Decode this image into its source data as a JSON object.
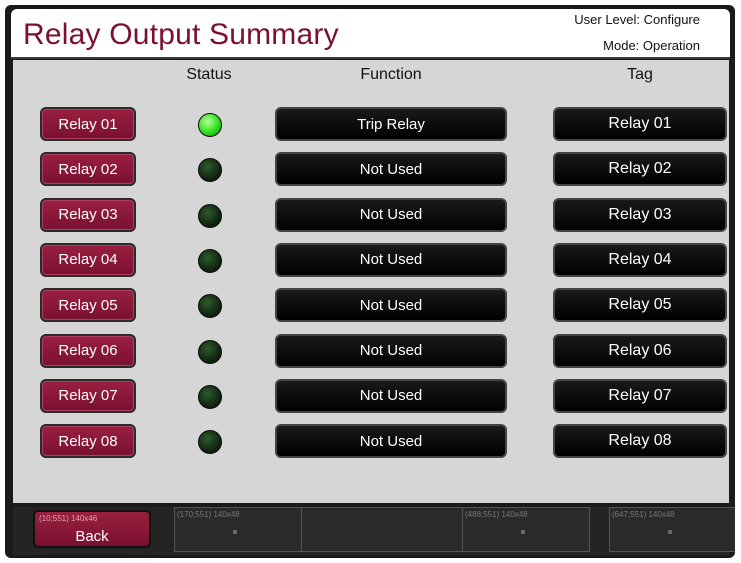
{
  "header": {
    "title": "Relay Output Summary",
    "user_level": "User Level: Configure",
    "mode": "Mode: Operation"
  },
  "columns": {
    "status": "Status",
    "function": "Function",
    "tag": "Tag"
  },
  "relays": [
    {
      "label": "Relay 01",
      "active": true,
      "function": "Trip Relay",
      "tag": "Relay 01"
    },
    {
      "label": "Relay 02",
      "active": false,
      "function": "Not Used",
      "tag": "Relay 02"
    },
    {
      "label": "Relay 03",
      "active": false,
      "function": "Not Used",
      "tag": "Relay 03"
    },
    {
      "label": "Relay 04",
      "active": false,
      "function": "Not Used",
      "tag": "Relay 04"
    },
    {
      "label": "Relay 05",
      "active": false,
      "function": "Not Used",
      "tag": "Relay 05"
    },
    {
      "label": "Relay 06",
      "active": false,
      "function": "Not Used",
      "tag": "Relay 06"
    },
    {
      "label": "Relay 07",
      "active": false,
      "function": "Not Used",
      "tag": "Relay 07"
    },
    {
      "label": "Relay 08",
      "active": false,
      "function": "Not Used",
      "tag": "Relay 08"
    }
  ],
  "footer": {
    "back_label": "Back",
    "back_slot": "(10;551) 140x46",
    "slot_2": "(170;551) 140x48",
    "slot_3": "(488;551) 140x48",
    "slot_4": "(647;551) 140x48"
  },
  "colors": {
    "accent": "#7a1030",
    "led_on": "#2ee01e",
    "led_off": "#0d1f0d"
  }
}
